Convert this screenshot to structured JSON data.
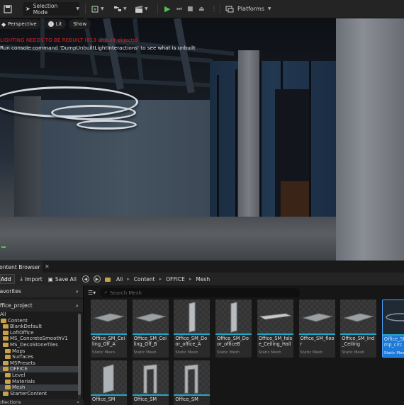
{
  "toolbar": {
    "selection_mode": "Selection Mode",
    "platforms": "Platforms"
  },
  "viewport": {
    "perspective": "Perspective",
    "lit": "Lit",
    "show": "Show",
    "error_message": "LIGHTING NEEDS TO BE REBUILT (813 unbuilt objects)",
    "info_message": "Run console command 'DumpUnbuiltLightInteractions' to see what is unbuilt"
  },
  "content_browser": {
    "tab_title": "Content Browser",
    "add": "Add",
    "import": "Import",
    "save_all": "Save All",
    "breadcrumb": [
      "All",
      "Content",
      "OFFICE",
      "Mesh"
    ],
    "favorites": "Favorites",
    "project": "Office_project",
    "tree": [
      {
        "label": "All",
        "indent": 0,
        "folder": false,
        "selected": false
      },
      {
        "label": "Content",
        "indent": 1,
        "folder": true,
        "selected": false
      },
      {
        "label": "BlankDefault",
        "indent": 2,
        "folder": true,
        "selected": false
      },
      {
        "label": "LoftOffice",
        "indent": 2,
        "folder": true,
        "selected": false
      },
      {
        "label": "MS_ConcreteSmoothV1",
        "indent": 2,
        "folder": true,
        "selected": false
      },
      {
        "label": "MS_DecoStoneTiles",
        "indent": 2,
        "folder": true,
        "selected": false
      },
      {
        "label": "Maps",
        "indent": 3,
        "folder": true,
        "selected": false
      },
      {
        "label": "Surfaces",
        "indent": 3,
        "folder": true,
        "selected": false
      },
      {
        "label": "MSPresets",
        "indent": 2,
        "folder": true,
        "selected": false
      },
      {
        "label": "OFFICE",
        "indent": 2,
        "folder": true,
        "selected": true
      },
      {
        "label": "Level",
        "indent": 3,
        "folder": true,
        "selected": false
      },
      {
        "label": "Materials",
        "indent": 3,
        "folder": true,
        "selected": false
      },
      {
        "label": "Mesh",
        "indent": 3,
        "folder": true,
        "selected": true
      },
      {
        "label": "StarterContent",
        "indent": 2,
        "folder": true,
        "selected": false
      }
    ],
    "collections": "Collections",
    "search_placeholder": "Search Mesh",
    "assets": [
      {
        "name": "Office_SM_Ceiling_Off_A",
        "type": "Static Mesh",
        "shape": "slab"
      },
      {
        "name": "Office_SM_Ceiling_Off_B",
        "type": "Static Mesh",
        "shape": "slab"
      },
      {
        "name": "Office_SM_Door_office_A",
        "type": "Static Mesh",
        "shape": "door"
      },
      {
        "name": "Office_SM_Door_officeB",
        "type": "Static Mesh",
        "shape": "door"
      },
      {
        "name": "Office_SM_false_Ceiling_Hall",
        "type": "Static Mesh",
        "shape": "bar"
      },
      {
        "name": "Office_SM_floor",
        "type": "Static Mesh",
        "shape": "slab"
      },
      {
        "name": "Office_SM_Ind_Ceiling",
        "type": "Static Mesh",
        "shape": "slab"
      },
      {
        "name": "Office_SM_Lamp_circ",
        "type": "Static Mesh",
        "shape": "lamp",
        "selected": true
      },
      {
        "name": "Office_SM",
        "type": "",
        "shape": "panel"
      },
      {
        "name": "Office_SM",
        "type": "",
        "shape": "arch"
      },
      {
        "name": "Office_SM",
        "type": "",
        "shape": "arch"
      }
    ]
  }
}
